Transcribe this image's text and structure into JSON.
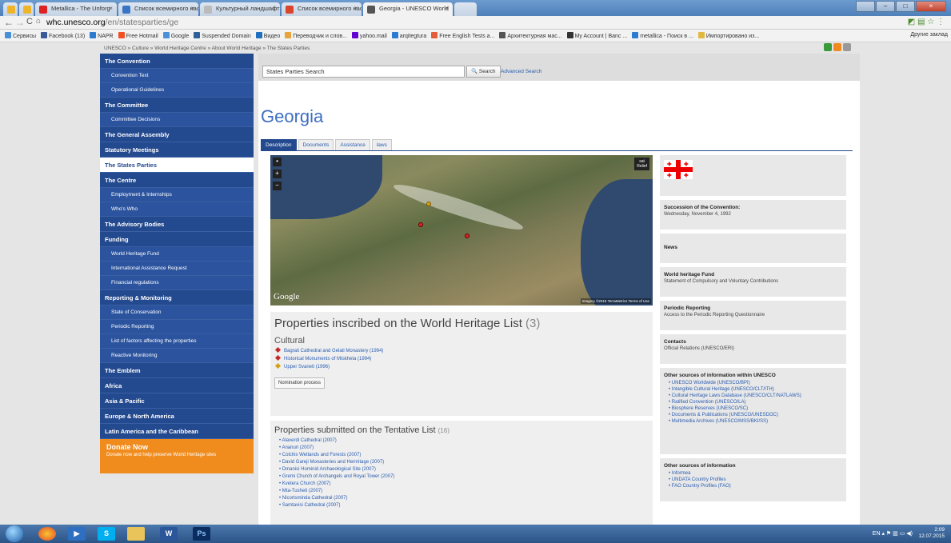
{
  "browser": {
    "tabs": [
      {
        "label": "Metallica - The Unforg"
      },
      {
        "label": "Список всемирного нас"
      },
      {
        "label": "Культурный ландшафт -"
      },
      {
        "label": "Список всемирного нас"
      },
      {
        "label": "Georgia - UNESCO World"
      }
    ],
    "url_host": "whc.unesco.org",
    "url_path": "/en/statesparties/ge",
    "bookmarks": [
      {
        "label": "Сервисы",
        "color": "#4a90d9"
      },
      {
        "label": "Facebook (13)",
        "color": "#3b5998"
      },
      {
        "label": "NAPR",
        "color": "#2b7bd0"
      },
      {
        "label": "Free Hotmail",
        "color": "#f25022"
      },
      {
        "label": "Google",
        "color": "#4a90d9"
      },
      {
        "label": "Suspended Domain",
        "color": "#2f5f98"
      },
      {
        "label": "Видео",
        "color": "#1f6fbf"
      },
      {
        "label": "Переводчик и слов...",
        "color": "#e8a43a"
      },
      {
        "label": "yahoo.mail",
        "color": "#6001d2"
      },
      {
        "label": "arqitegtura",
        "color": "#2b7bd0"
      },
      {
        "label": "Free English Tests a...",
        "color": "#e35d3a"
      },
      {
        "label": "Архитектурная мас...",
        "color": "#555555"
      },
      {
        "label": "My Account | Banc ...",
        "color": "#333333"
      },
      {
        "label": "metallica - Поиск в ...",
        "color": "#2b7bd0"
      },
      {
        "label": "Импортировано из...",
        "color": "#e0b840"
      }
    ],
    "other_bookmarks": "Другие заклад"
  },
  "breadcrumb": "UNESCO » Culture » World Heritage Centre » About World Heritage » The States Parties",
  "sidebar": {
    "items": [
      {
        "label": "The Convention",
        "type": "main"
      },
      {
        "label": "Convention Text",
        "type": "sub"
      },
      {
        "label": "Operational Guidelines",
        "type": "sub"
      },
      {
        "label": "The Committee",
        "type": "main"
      },
      {
        "label": "Committee Decisions",
        "type": "sub"
      },
      {
        "label": "The General Assembly",
        "type": "main"
      },
      {
        "label": "Statutory Meetings",
        "type": "main"
      },
      {
        "label": "The States Parties",
        "type": "active"
      },
      {
        "label": "The Centre",
        "type": "main"
      },
      {
        "label": "Employment & Internships",
        "type": "sub"
      },
      {
        "label": "Who's Who",
        "type": "sub"
      },
      {
        "label": "The Advisory Bodies",
        "type": "main"
      },
      {
        "label": "Funding",
        "type": "main"
      },
      {
        "label": "World Heritage Fund",
        "type": "sub"
      },
      {
        "label": "International Assistance Request",
        "type": "sub"
      },
      {
        "label": "Financial regulations",
        "type": "sub"
      },
      {
        "label": "Reporting & Monitoring",
        "type": "main"
      },
      {
        "label": "State of Conservation",
        "type": "sub"
      },
      {
        "label": "Periodic Reporting",
        "type": "sub"
      },
      {
        "label": "List of factors affecting the properties",
        "type": "sub"
      },
      {
        "label": "Reactive Monitoring",
        "type": "sub"
      },
      {
        "label": "The Emblem",
        "type": "main"
      },
      {
        "label": "Africa",
        "type": "main"
      },
      {
        "label": "Asia & Pacific",
        "type": "main"
      },
      {
        "label": "Europe & North America",
        "type": "main"
      },
      {
        "label": "Latin America and the Caribbean",
        "type": "main"
      }
    ],
    "donate_title": "Donate Now",
    "donate_sub": "Donate now and help preserve World Heritage sites"
  },
  "search": {
    "value": "States Parties Search",
    "button": "Search",
    "advanced": "Advanced Search"
  },
  "page_title": "Georgia",
  "tabs": [
    "Description",
    "Documents",
    "Assistance",
    "laws"
  ],
  "map": {
    "relief_label": "sat\nRelief",
    "logo": "Google",
    "attribution": "Imagery ©2015 TerraMetrics  Terms of Use"
  },
  "properties": {
    "heading": "Properties inscribed on the World Heritage List",
    "count": "(3)",
    "category": "Cultural",
    "items": [
      {
        "label": "Bagrati Cathedral and Gelati Monastery (1994)",
        "color": "#c62828"
      },
      {
        "label": "Historical Monuments of Mtskheta (1994)",
        "color": "#c62828"
      },
      {
        "label": "Upper Svaneti (1996)",
        "color": "#d4a017"
      }
    ],
    "nomination_button": "Nomination process"
  },
  "tentative": {
    "heading": "Properties submitted on the Tentative List",
    "count": "(16)",
    "items": [
      "Alaverdi Cathedral (2007)",
      "Ananuri (2007)",
      "Colchis Wetlands and Forests (2007)",
      "David Gareji Monasteries and Hermitage (2007)",
      "Dmanisi Hominid Archaeological Site (2007)",
      "Gremi Church of Archangels and Royal Tower (2007)",
      "Kvetera Church (2007)",
      "Mta-Tusheti (2007)",
      "Nicortsminda Cathedral (2007)",
      "Samtavisi Cathedral (2007)"
    ]
  },
  "right": {
    "succession_h": "Succession of the Convention:",
    "succession_v": "Wednesday, November 4, 1992",
    "news_h": "News",
    "fund_h": "World heritage Fund",
    "fund_v": "Statement of Compulsory and Voluntary Contributions",
    "periodic_h": "Periodic Reporting",
    "periodic_v": "Access to the Periodic Reporting Questionnaire",
    "contacts_h": "Contacts",
    "contacts_v": "Official Relations (UNESCO/ERI)",
    "unesco_h": "Other sources of information within UNESCO",
    "unesco_items": [
      "UNESCO Worldwide (UNESCO/BPI)",
      "Intangible Cultural Heritage (UNESCO/CLT/ITH)",
      "Cultural Heritage Laws Database (UNESCO/CLT/NATLAWS)",
      "Ratified Convention (UNESCO/LA)",
      "Biosphere Reserves (UNESCO/SC)",
      "Documents & Publications (UNESCO/UNESDOC)",
      "Multimedia Archives (UNESCO/MSS/BKI/SS)"
    ],
    "other_h": "Other sources of information",
    "other_items": [
      "Informea",
      "UNDATA Country Profiles",
      "FAO Country Profiles (FAO)"
    ]
  },
  "taskbar": {
    "lang": "EN",
    "time": "2:09",
    "date": "12.07.2015"
  },
  "colors": {
    "sidebar_bg": "#23498f",
    "title": "#3d6ec1",
    "donate": "#f08c1e"
  }
}
